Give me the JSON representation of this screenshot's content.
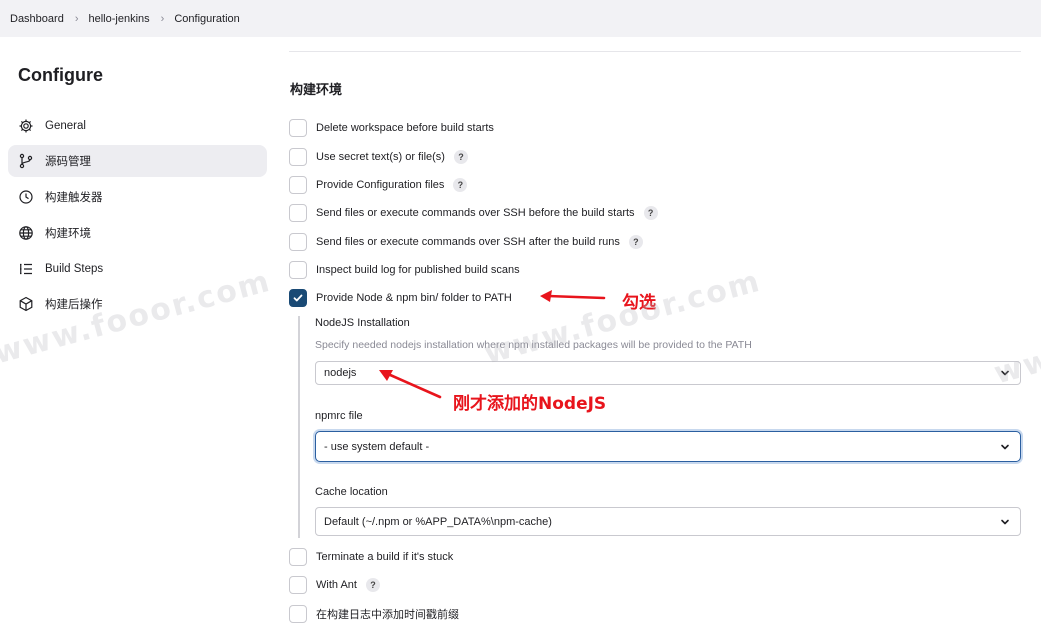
{
  "breadcrumb": {
    "items": [
      "Dashboard",
      "hello-jenkins",
      "Configuration"
    ],
    "separator": "›"
  },
  "sidebar": {
    "title": "Configure",
    "items": [
      {
        "label": "General",
        "icon": "gear-icon"
      },
      {
        "label": "源码管理",
        "icon": "branch-icon",
        "active": true
      },
      {
        "label": "构建触发器",
        "icon": "clock-icon"
      },
      {
        "label": "构建环境",
        "icon": "globe-icon"
      },
      {
        "label": "Build Steps",
        "icon": "list-icon"
      },
      {
        "label": "构建后操作",
        "icon": "cube-icon"
      }
    ]
  },
  "main": {
    "section_title": "构建环境",
    "options": [
      {
        "label": "Delete workspace before build starts",
        "checked": false,
        "help": false
      },
      {
        "label": "Use secret text(s) or file(s)",
        "checked": false,
        "help": true
      },
      {
        "label": "Provide Configuration files",
        "checked": false,
        "help": true
      },
      {
        "label": "Send files or execute commands over SSH before the build starts",
        "checked": false,
        "help": true
      },
      {
        "label": "Send files or execute commands over SSH after the build runs",
        "checked": false,
        "help": true
      },
      {
        "label": "Inspect build log for published build scans",
        "checked": false,
        "help": false
      },
      {
        "label": "Provide Node & npm bin/ folder to PATH",
        "checked": true,
        "help": false
      }
    ],
    "nodejs": {
      "installation_label": "NodeJS Installation",
      "installation_desc": "Specify needed nodejs installation where npm installed packages will be provided to the PATH",
      "installation_value": "nodejs",
      "npmrc_label": "npmrc file",
      "npmrc_value": "- use system default -",
      "cache_label": "Cache location",
      "cache_value": "Default (~/.npm or %APP_DATA%\\npm-cache)"
    },
    "options_after": [
      {
        "label": "Terminate a build if it's stuck",
        "checked": false,
        "help": false
      },
      {
        "label": "With Ant",
        "checked": false,
        "help": true
      },
      {
        "label": "在构建日志中添加时间戳前缀",
        "checked": false,
        "help": false
      }
    ],
    "help_glyph": "?"
  },
  "annotations": {
    "check_note": "勾选",
    "nodejs_note": "刚才添加的NodeJS",
    "color": "#e8141c"
  },
  "watermark": "www.fooor.com",
  "colors": {
    "accent": "#1a4a75",
    "focus": "#2b5fa0",
    "breadcrumb_bg": "#f2f2f5",
    "active_item_bg": "#ededf1"
  }
}
